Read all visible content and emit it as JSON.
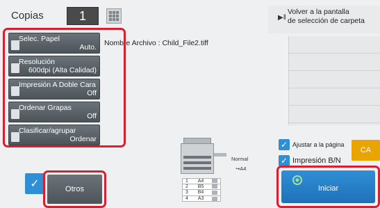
{
  "copies": {
    "label": "Copias",
    "value": "1"
  },
  "file": {
    "label": "Nombre Archivo",
    "separator": ":",
    "name": "Child_File2.tiff"
  },
  "settings": [
    {
      "label": "Selec. Papel",
      "value": "Auto."
    },
    {
      "label": "Resolución",
      "value": "600dpi (Alta Calidad)"
    },
    {
      "label": "Impresión A Doble Cara",
      "value": "Off"
    },
    {
      "label": "Ordenar Grapas",
      "value": "Off"
    },
    {
      "label": "Clasificar/agrupar",
      "value": "Ordenar"
    }
  ],
  "return_button": {
    "line1": "Volver a la pantalla",
    "line2": "de selección de carpeta"
  },
  "options": {
    "fit_page": {
      "label": "Ajustar a la página",
      "checked": true
    },
    "bw_print": {
      "label": "Impresión B/N",
      "checked": true
    }
  },
  "buttons": {
    "ca": "CA",
    "start": "Iniciar",
    "others": "Otros"
  },
  "output": {
    "mode": "Normal",
    "size": "A4"
  },
  "trays": [
    {
      "n": "1",
      "size": "A4"
    },
    {
      "n": "2",
      "size": "B5"
    },
    {
      "n": "3",
      "size": "B4"
    },
    {
      "n": "4",
      "size": "A3"
    }
  ],
  "colors": {
    "highlight": "#d91e2f",
    "accent": "#2f8fd6",
    "ca": "#e9a400",
    "button": "#5b6269"
  }
}
